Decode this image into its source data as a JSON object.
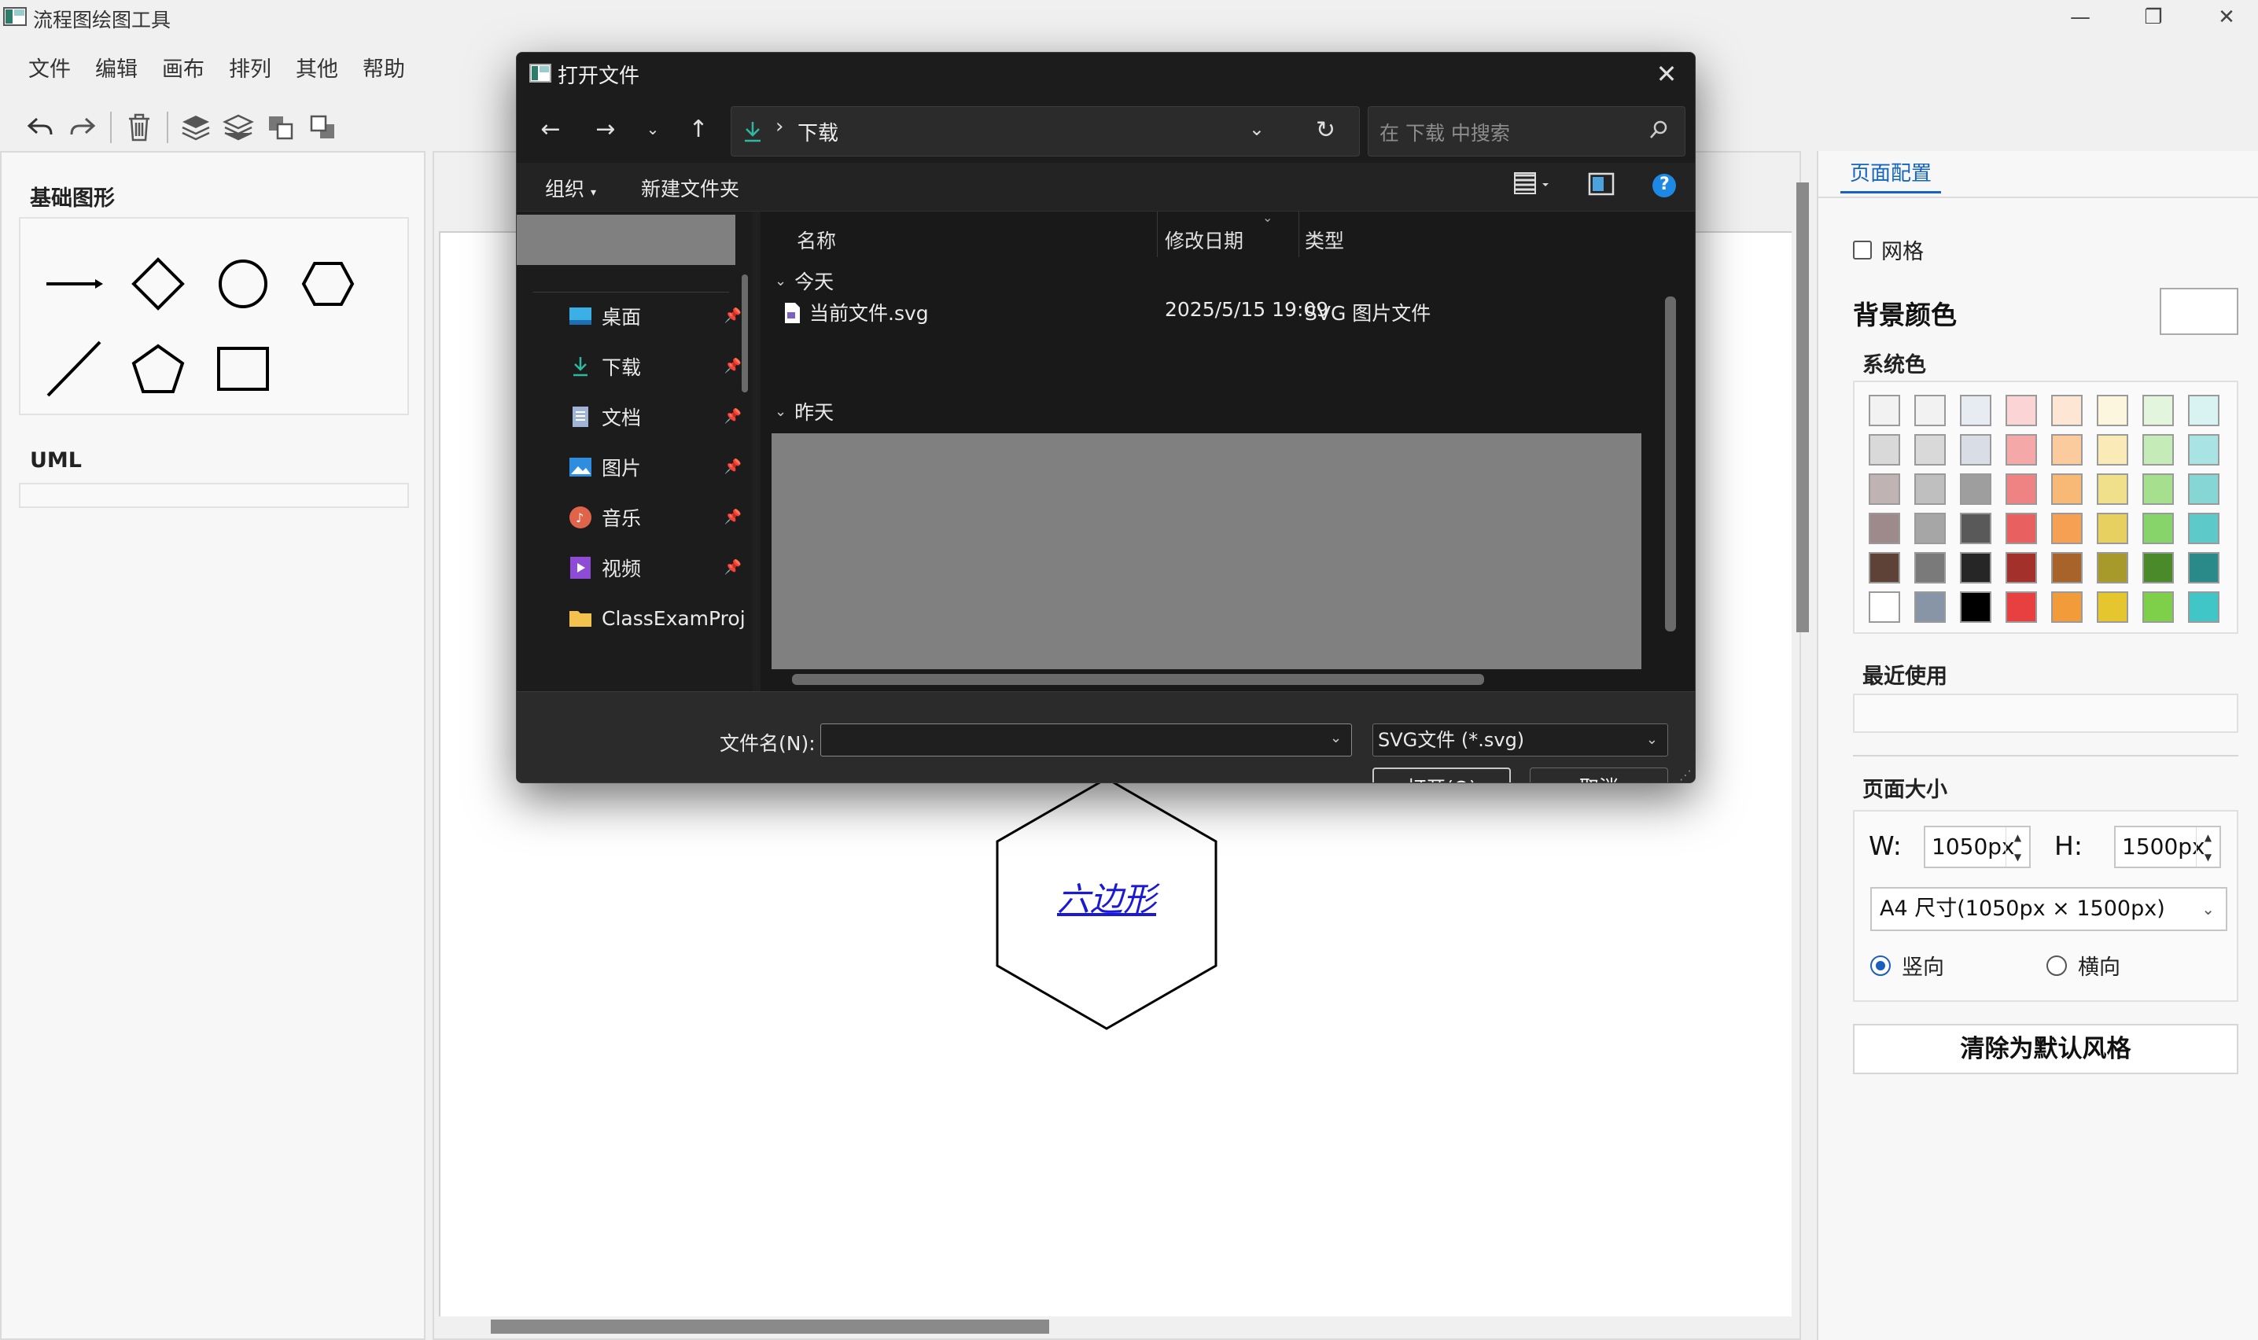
{
  "app": {
    "title": "流程图绘图工具"
  },
  "window_controls": {
    "minimize": "—",
    "restore": "❐",
    "close": "✕"
  },
  "menubar": [
    "文件",
    "编辑",
    "画布",
    "排列",
    "其他",
    "帮助"
  ],
  "toolbar": {
    "icons": [
      "undo-icon",
      "redo-icon",
      "delete-icon",
      "bring-front-layer-icon",
      "send-back-layer-icon",
      "bring-forward-icon",
      "send-backward-icon"
    ]
  },
  "left_panel": {
    "basic_shapes_heading": "基础图形",
    "shapes": [
      "arrow-line",
      "diamond",
      "circle",
      "hexagon",
      "line",
      "pentagon",
      "rectangle"
    ],
    "uml_heading": "UML"
  },
  "canvas": {
    "hexagon_label": "六边形"
  },
  "right_panel": {
    "tab": "页面配置",
    "grid_label": "网格",
    "grid_checked": false,
    "bg_color_label": "背景颜色",
    "bg_color_value": "#ffffff",
    "system_colors_label": "系统色",
    "palette": [
      [
        "#f2f2f2",
        "#f2f2f2",
        "#e6ecf2",
        "#fbd5d5",
        "#fde6d3",
        "#fdf6de",
        "#e3f5dc",
        "#d9f2f2"
      ],
      [
        "#d9d9d9",
        "#d9d9d9",
        "#d8dde6",
        "#f4a8a8",
        "#fbcb9e",
        "#f9eab7",
        "#c4ebb8",
        "#a9e3e3"
      ],
      [
        "#bfb3b3",
        "#bfbfbf",
        "#9e9e9e",
        "#ef8282",
        "#f8b876",
        "#f1e08b",
        "#a6e08e",
        "#86d6d6"
      ],
      [
        "#9e8a8a",
        "#a6a6a6",
        "#595959",
        "#e86060",
        "#f5a053",
        "#e7d05f",
        "#87d46b",
        "#5ec9c9"
      ],
      [
        "#5e4238",
        "#7a7a7a",
        "#262626",
        "#a3302a",
        "#a8632b",
        "#a89a2a",
        "#4a8a2a",
        "#2a8a8a"
      ],
      [
        "#ffffff",
        "#8795a6",
        "#000000",
        "#e84040",
        "#f29b3a",
        "#e6c62e",
        "#7ed04a",
        "#40c6c6"
      ]
    ],
    "recent_label": "最近使用",
    "page_size_label": "页面大小",
    "width_label": "W:",
    "width_value": "1050px",
    "height_label": "H:",
    "height_value": "1500px",
    "page_size_preset": "A4 尺寸(1050px × 1500px)",
    "orientation_portrait": "竖向",
    "orientation_landscape": "横向",
    "orientation_selected": "portrait",
    "reset_button": "清除为默认风格"
  },
  "dialog": {
    "title": "打开文件",
    "close": "✕",
    "address": "下载",
    "search_placeholder": "在 下载 中搜索",
    "organize": "组织",
    "new_folder": "新建文件夹",
    "help": "?",
    "quick_access": [
      {
        "label": "桌面",
        "icon": "desktop-icon"
      },
      {
        "label": "下载",
        "icon": "download-icon"
      },
      {
        "label": "文档",
        "icon": "document-icon"
      },
      {
        "label": "图片",
        "icon": "pictures-icon"
      },
      {
        "label": "音乐",
        "icon": "music-icon"
      },
      {
        "label": "视频",
        "icon": "video-icon"
      },
      {
        "label": "ClassExamProj",
        "icon": "folder-icon"
      }
    ],
    "columns": {
      "name": "名称",
      "modified": "修改日期",
      "type": "类型"
    },
    "groups": {
      "today": "今天",
      "yesterday": "昨天"
    },
    "files": [
      {
        "name": "当前文件.svg",
        "modified": "2025/5/15 19:09",
        "type": "SVG 图片文件"
      }
    ],
    "filename_label": "文件名(N):",
    "filename_value": "",
    "filetype": "SVG文件 (*.svg)",
    "open_button": "打开(O)",
    "cancel_button": "取消"
  }
}
